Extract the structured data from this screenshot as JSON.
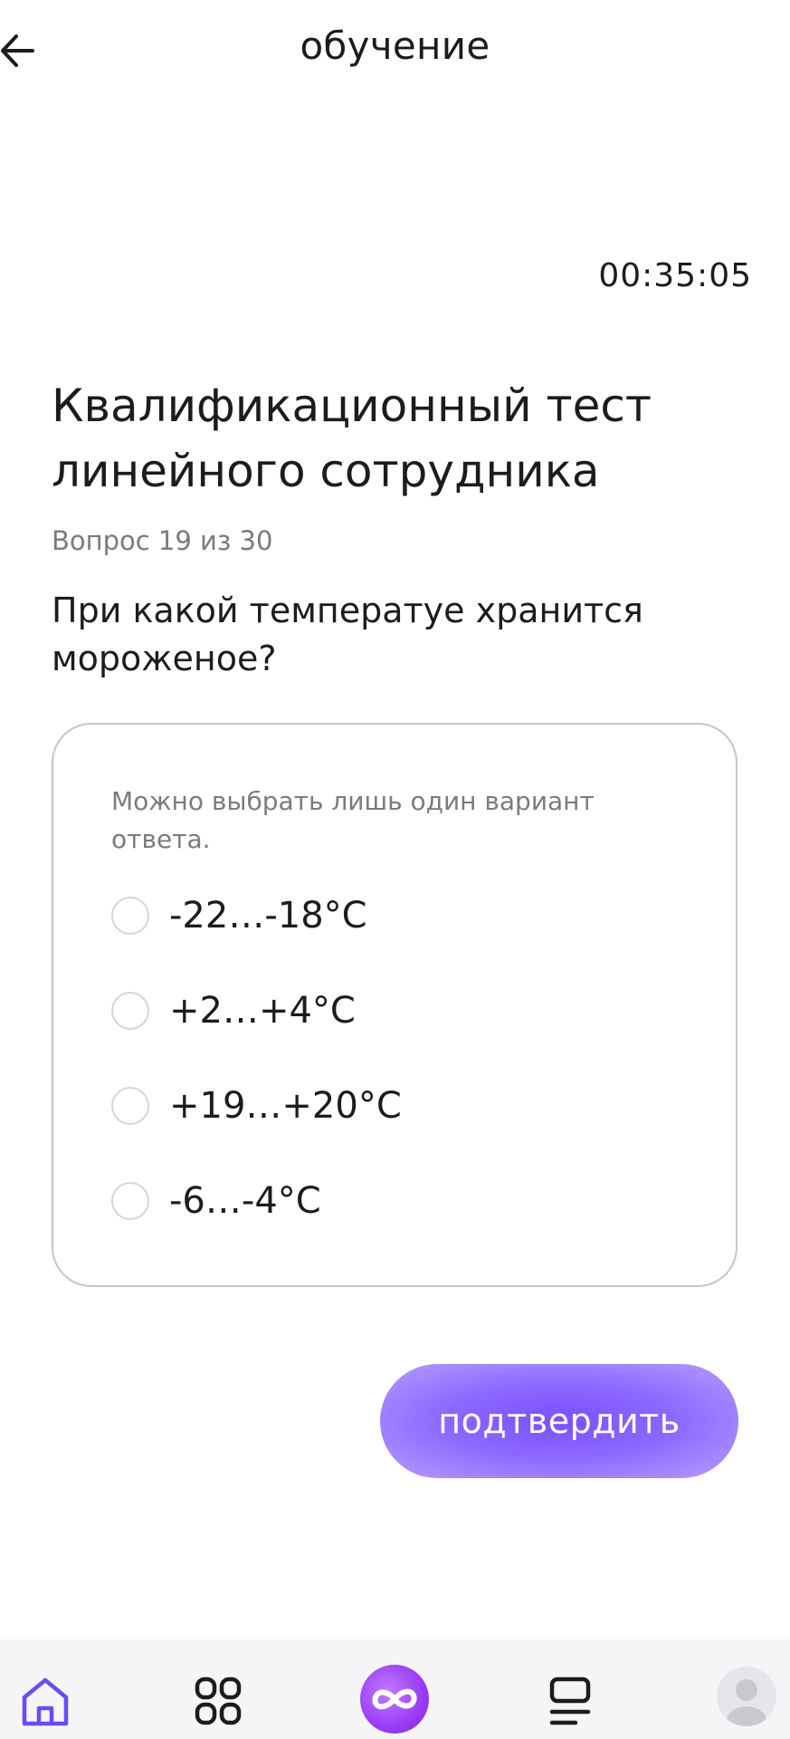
{
  "header": {
    "title": "обучение",
    "back_icon": "arrow-left-icon"
  },
  "timer": "00:35:05",
  "test": {
    "title": "Квалификационный тест линейного сотрудника",
    "counter": "Вопрос 19 из 30",
    "question": "При какой температуе хранится мороженое?"
  },
  "answers": {
    "hint": "Можно выбрать лишь один вариант ответа.",
    "options": [
      {
        "label": "-22…-18°C",
        "selected": false
      },
      {
        "label": "+2…+4°C",
        "selected": false
      },
      {
        "label": "+19…+20°C",
        "selected": false
      },
      {
        "label": "-6…-4°C",
        "selected": false
      }
    ]
  },
  "confirm_label": "подтвердить",
  "bottom_nav": {
    "items": [
      {
        "icon": "home-icon",
        "active": true
      },
      {
        "icon": "grid-icon",
        "active": false
      },
      {
        "icon": "infinity-icon",
        "active": false
      },
      {
        "icon": "list-icon",
        "active": false
      },
      {
        "icon": "avatar-icon",
        "active": false
      }
    ]
  },
  "colors": {
    "accent": "#7b50ff",
    "text": "#1c1c1e",
    "muted": "#7a7a80",
    "card_border": "#c2c5cc",
    "nav_background": "#f5f5f7"
  }
}
